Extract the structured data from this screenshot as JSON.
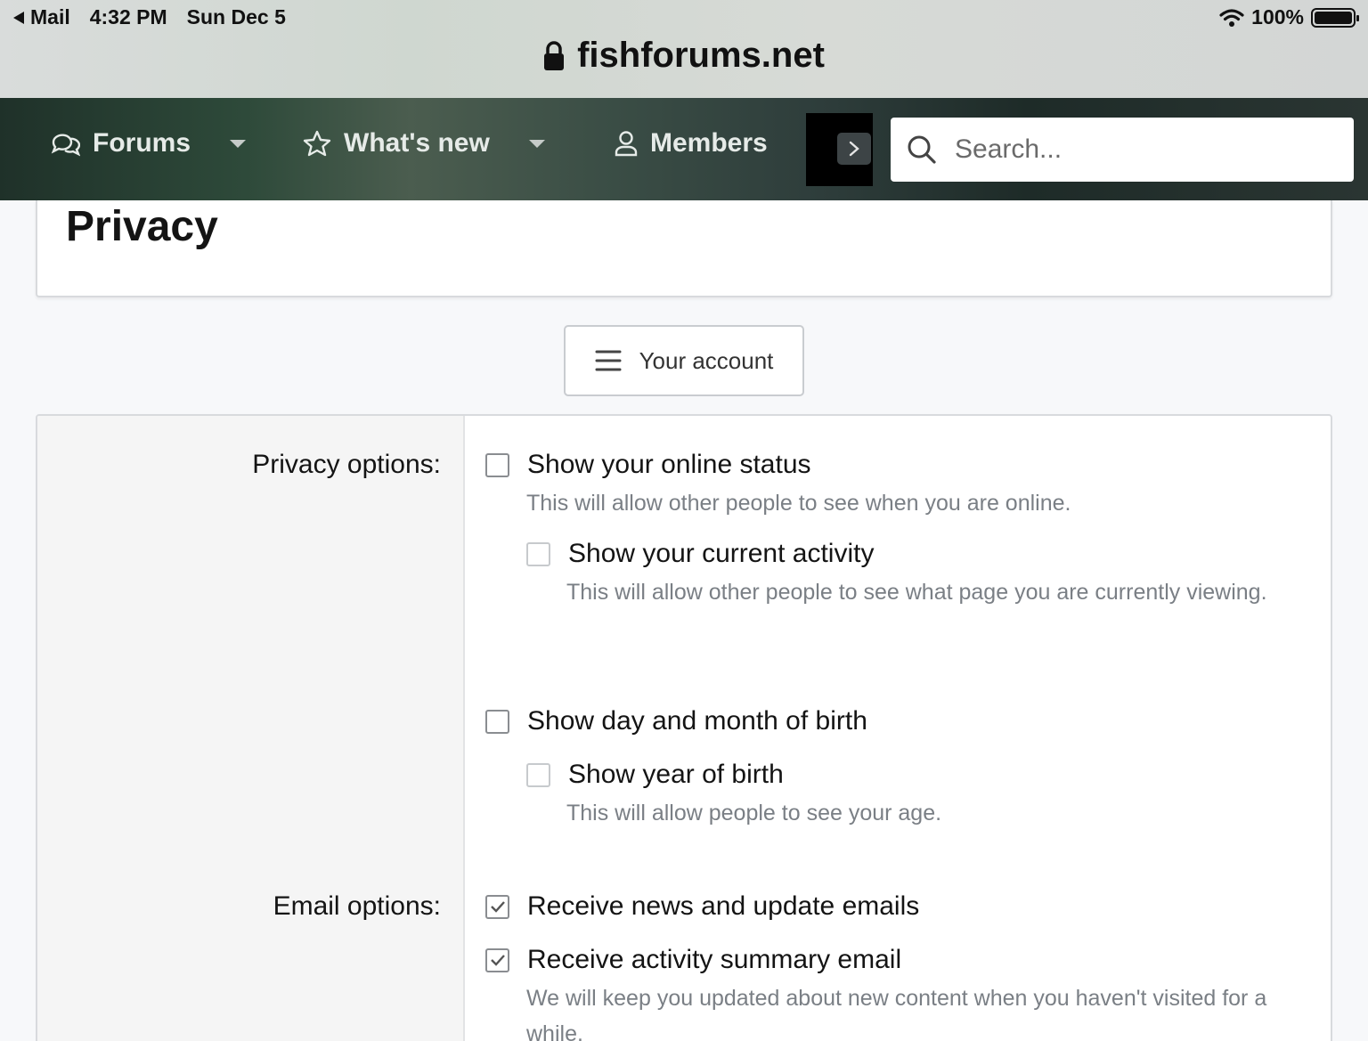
{
  "status_bar": {
    "back_app": "Mail",
    "time": "4:32 PM",
    "date": "Sun Dec 5",
    "battery_text": "100%"
  },
  "browser": {
    "url": "fishforums.net"
  },
  "nav": {
    "items": [
      {
        "label": "Forums"
      },
      {
        "label": "What's new"
      },
      {
        "label": "Members"
      }
    ],
    "search_placeholder": "Search..."
  },
  "page": {
    "title": "Privacy",
    "account_button": "Your account"
  },
  "form": {
    "privacy_label": "Privacy options:",
    "email_label": "Email options:",
    "options": {
      "online_status": {
        "label": "Show your online status",
        "hint": "This will allow other people to see when you are online.",
        "checked": false
      },
      "current_activity": {
        "label": "Show your current activity",
        "hint": "This will allow other people to see what page you are currently viewing.",
        "checked": false
      },
      "dob": {
        "label": "Show day and month of birth",
        "checked": false
      },
      "year_of_birth": {
        "label": "Show year of birth",
        "hint": "This will allow people to see your age.",
        "checked": false
      },
      "news_emails": {
        "label": "Receive news and update emails",
        "checked": true
      },
      "activity_summary": {
        "label": "Receive activity summary email",
        "hint": "We will keep you updated about new content when you haven't visited for a while.",
        "checked": true
      }
    }
  },
  "colors": {
    "nav_text": "#e6ebe8",
    "hint_text": "#7a7f85",
    "checkbox_border": "#8a8d91"
  }
}
